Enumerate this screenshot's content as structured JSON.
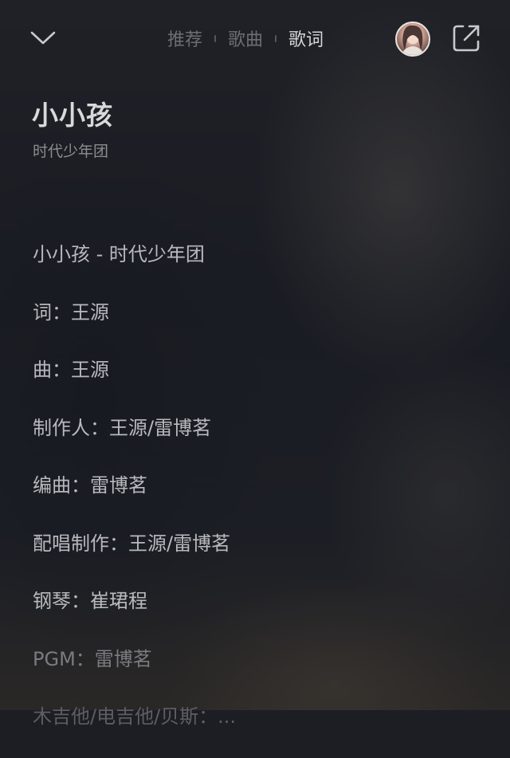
{
  "header": {
    "tabs": [
      {
        "label": "推荐",
        "active": false
      },
      {
        "label": "歌曲",
        "active": false
      },
      {
        "label": "歌词",
        "active": true
      }
    ],
    "icons": {
      "back": "chevron-down-icon",
      "share": "share-external-icon"
    }
  },
  "song": {
    "title": "小小孩",
    "artist": "时代少年团"
  },
  "lyrics": {
    "lines": [
      "小小孩 - 时代少年团",
      "词：王源",
      "曲：王源",
      "制作人：王源/雷博茗",
      "编曲：雷博茗",
      "配唱制作：王源/雷博茗",
      "钢琴：崔珺程",
      "PGM：雷博茗",
      "木吉他/电吉他/贝斯：..."
    ]
  },
  "colors": {
    "background": "#1d1e24",
    "active_tab": "#d6d6d8",
    "inactive_tab": "#6d6e73",
    "lyric_text": "#b8b9bd"
  }
}
